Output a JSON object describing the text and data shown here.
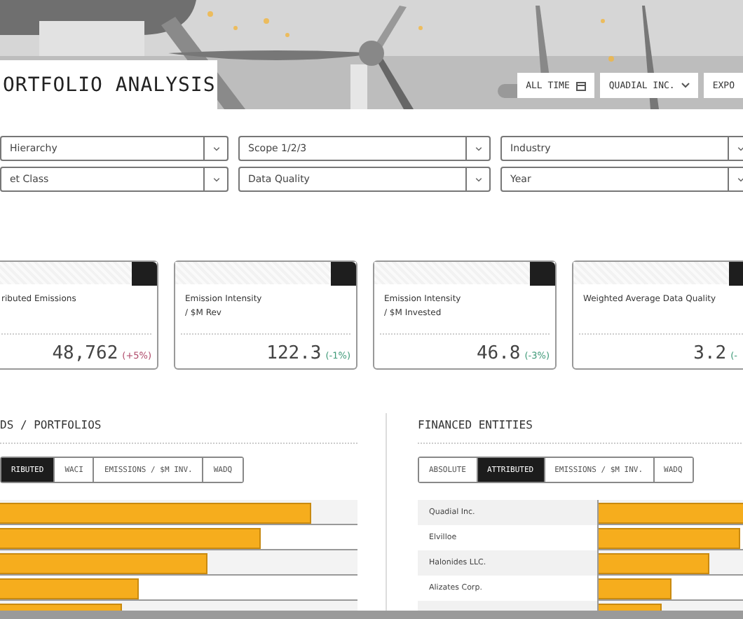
{
  "header": {
    "title": "ORTFOLIO ANALYSIS",
    "buttons": [
      {
        "label": "ALL TIME",
        "kind": "calendar"
      },
      {
        "label": "QUADIAL INC.",
        "kind": "dropdown"
      },
      {
        "label": "EXPO",
        "kind": "plain"
      }
    ]
  },
  "filters": [
    {
      "value": "Hierarchy"
    },
    {
      "value": "Scope 1/2/3"
    },
    {
      "value": "Industry"
    },
    {
      "value": "et Class"
    },
    {
      "value": "Data Quality"
    },
    {
      "value": "Year"
    }
  ],
  "cards": [
    {
      "label": "ributed Emissions",
      "value": "48,762",
      "change": "(+5%)",
      "color": "#b04a6a"
    },
    {
      "label": "Emission Intensity\n/ $M Rev",
      "value": "122.3",
      "change": "(-1%)",
      "color": "#3f9a78"
    },
    {
      "label": "Emission Intensity\n/ $M Invested",
      "value": "46.8",
      "change": "(-3%)",
      "color": "#3f9a78"
    },
    {
      "label": "Weighted Average Data Quality",
      "value": "3.2",
      "change": "(-",
      "color": "#3f9a78"
    }
  ],
  "funds": {
    "title": "DS / PORTFOLIOS",
    "tabs": [
      {
        "label": "RIBUTED",
        "selected": true
      },
      {
        "label": "WACI",
        "selected": false
      },
      {
        "label": "EMISSIONS / $M INV.",
        "selected": false
      },
      {
        "label": "WADQ",
        "selected": false
      }
    ],
    "bars": [
      {
        "level": 0.87
      },
      {
        "level": 0.73
      },
      {
        "level": 0.58
      },
      {
        "level": 0.39
      },
      {
        "level": 0.34
      }
    ]
  },
  "entities": {
    "title": "FINANCED ENTITIES",
    "tabs": [
      {
        "label": "ABSOLUTE",
        "selected": false
      },
      {
        "label": "ATTRIBUTED",
        "selected": true
      },
      {
        "label": "EMISSIONS / $M INV.",
        "selected": false
      },
      {
        "label": "WADQ",
        "selected": false
      }
    ],
    "rows": [
      {
        "name": "Quadial Inc.",
        "level": 0.97
      },
      {
        "name": "Elvilloe",
        "level": 0.8
      },
      {
        "name": "Halonides LLC.",
        "level": 0.63
      },
      {
        "name": "Alizates Corp.",
        "level": 0.41
      },
      {
        "level": 0.36
      }
    ]
  }
}
